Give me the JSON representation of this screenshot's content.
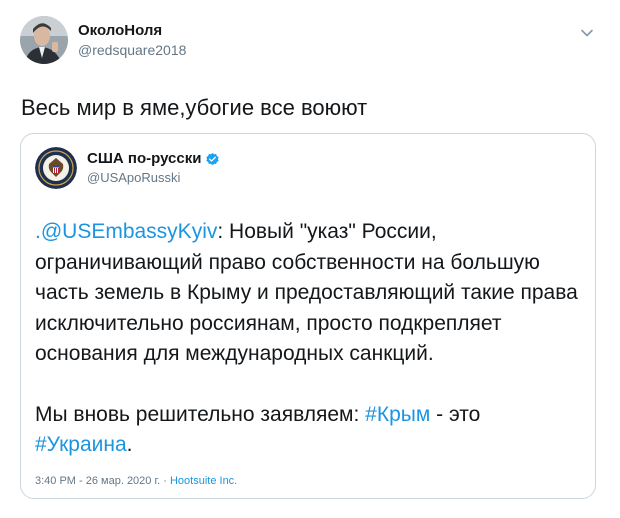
{
  "tweet": {
    "author": {
      "display_name": "ОколоНоля",
      "handle": "@redsquare2018",
      "avatar_icon": "user-avatar-photo"
    },
    "menu_icon": "chevron-down-icon",
    "text": "Весь мир в яме,убогие все воюют"
  },
  "quoted_tweet": {
    "author": {
      "display_name": "США по-русски",
      "handle": "@USApoRusski",
      "avatar_icon": "state-department-seal-icon",
      "verified_icon": "verified-badge-icon"
    },
    "body": {
      "mention": ".@USEmbassyKyiv",
      "para1_text": ": Новый \"указ\" России, ограничивающий право собственности на большую часть земель в Крыму и предоставляющий такие права исключительно россиянам, просто подкрепляет основания для международных санкций.",
      "para2_text": "Мы вновь решительно заявляем: ",
      "hashtag1": "#Крым",
      "dash": " - это ",
      "hashtag2": "#Украина",
      "end": "."
    },
    "meta": {
      "time": "3:40 PM - 26 мар. 2020 г. · ",
      "source": "Hootsuite Inc."
    }
  },
  "colors": {
    "link": "#1b95e0",
    "secondary_text": "#657786",
    "border": "#ccd6dd",
    "primary_text": "#14171a"
  }
}
